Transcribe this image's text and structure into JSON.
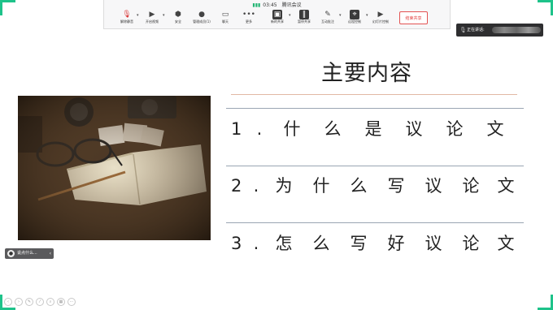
{
  "colors": {
    "accent": "#1ec38a",
    "end_button": "#e33b3b",
    "title_rule": "#e1b8a4"
  },
  "meeting": {
    "time": "03:45",
    "title": "腾讯会议"
  },
  "toolbar": {
    "buttons": [
      {
        "label": "解除静音",
        "icon": "mic-muted-icon"
      },
      {
        "label": "开启视频",
        "icon": "camera-icon"
      },
      {
        "label": "安全",
        "icon": "shield-icon"
      },
      {
        "label": "管理成员(1)",
        "icon": "members-icon"
      },
      {
        "label": "聊天",
        "icon": "chat-icon"
      },
      {
        "label": "更多",
        "icon": "more-icon"
      },
      {
        "label": "新的共享",
        "icon": "share-screen-icon"
      },
      {
        "label": "暂停共享",
        "icon": "pause-icon"
      },
      {
        "label": "互动批注",
        "icon": "annotate-icon"
      },
      {
        "label": "远程控制",
        "icon": "remote-control-icon"
      },
      {
        "label": "幻灯片控制",
        "icon": "slideshow-icon"
      }
    ],
    "end_share": "结束共享"
  },
  "speaking": {
    "label": "正在讲话:"
  },
  "slide": {
    "title": "主要内容",
    "items": [
      {
        "num": "1",
        "dot": ".",
        "chars": [
          "什",
          "么",
          "是",
          "议",
          "论",
          "文"
        ]
      },
      {
        "num": "2",
        "dot": ".",
        "chars": [
          "为",
          "什",
          "么",
          "写",
          "议",
          "论",
          "文"
        ]
      },
      {
        "num": "3",
        "dot": ".",
        "chars": [
          "怎",
          "么",
          "写",
          "好",
          "议",
          "论",
          "文"
        ]
      }
    ]
  },
  "mini_pill": {
    "text": "说点什么..."
  }
}
